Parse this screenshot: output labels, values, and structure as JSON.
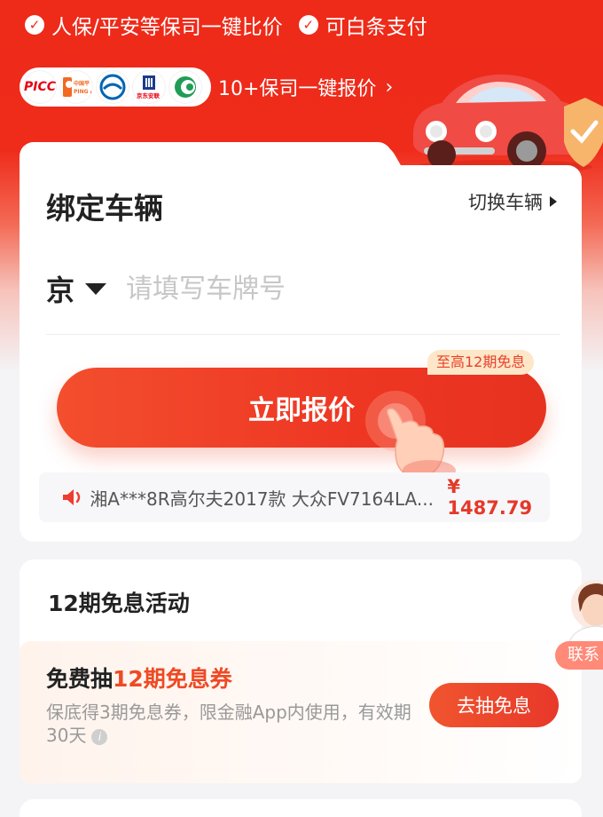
{
  "benefits": [
    {
      "label": "人保/平安等保司一键比价"
    },
    {
      "label": "可白条支付"
    }
  ],
  "insurers": {
    "logos": [
      {
        "icon": "picc-logo",
        "text": "PICC",
        "color": "#e60012"
      },
      {
        "icon": "pingan-logo",
        "text": "中国平安 PING A",
        "color": "#f26a21"
      },
      {
        "icon": "cpic-logo",
        "text": "",
        "color": "#0064b4"
      },
      {
        "icon": "jd-allianz-logo",
        "text": "京东安联",
        "color": "#1b3a8c"
      },
      {
        "icon": "chinalife-logo",
        "text": "",
        "color": "#1f9d55"
      }
    ],
    "compare_link": "10+保司一键报价"
  },
  "bind_card": {
    "title": "绑定车辆",
    "switch_label": "切换车辆",
    "province": "京",
    "plate_placeholder": "请填写车牌号",
    "free_tag": "至高12期免息",
    "quote_button": "立即报价",
    "ticker_text": "湘A***8R高尔夫2017款 大众FV7164LA...",
    "ticker_price": "¥ 1487.79"
  },
  "promo": {
    "section_title": "12期免息活动",
    "offer_prefix": "免费抽",
    "offer_highlight": "12期免息券",
    "offer_desc": "保底得3期免息券，限金融App内使用，有效期30天",
    "draw_button": "去抽免息",
    "agent_label": "联系"
  },
  "colors": {
    "brand_red": "#ee2a19",
    "accent_orange": "#ee4a24",
    "price_red": "#e4392a"
  }
}
